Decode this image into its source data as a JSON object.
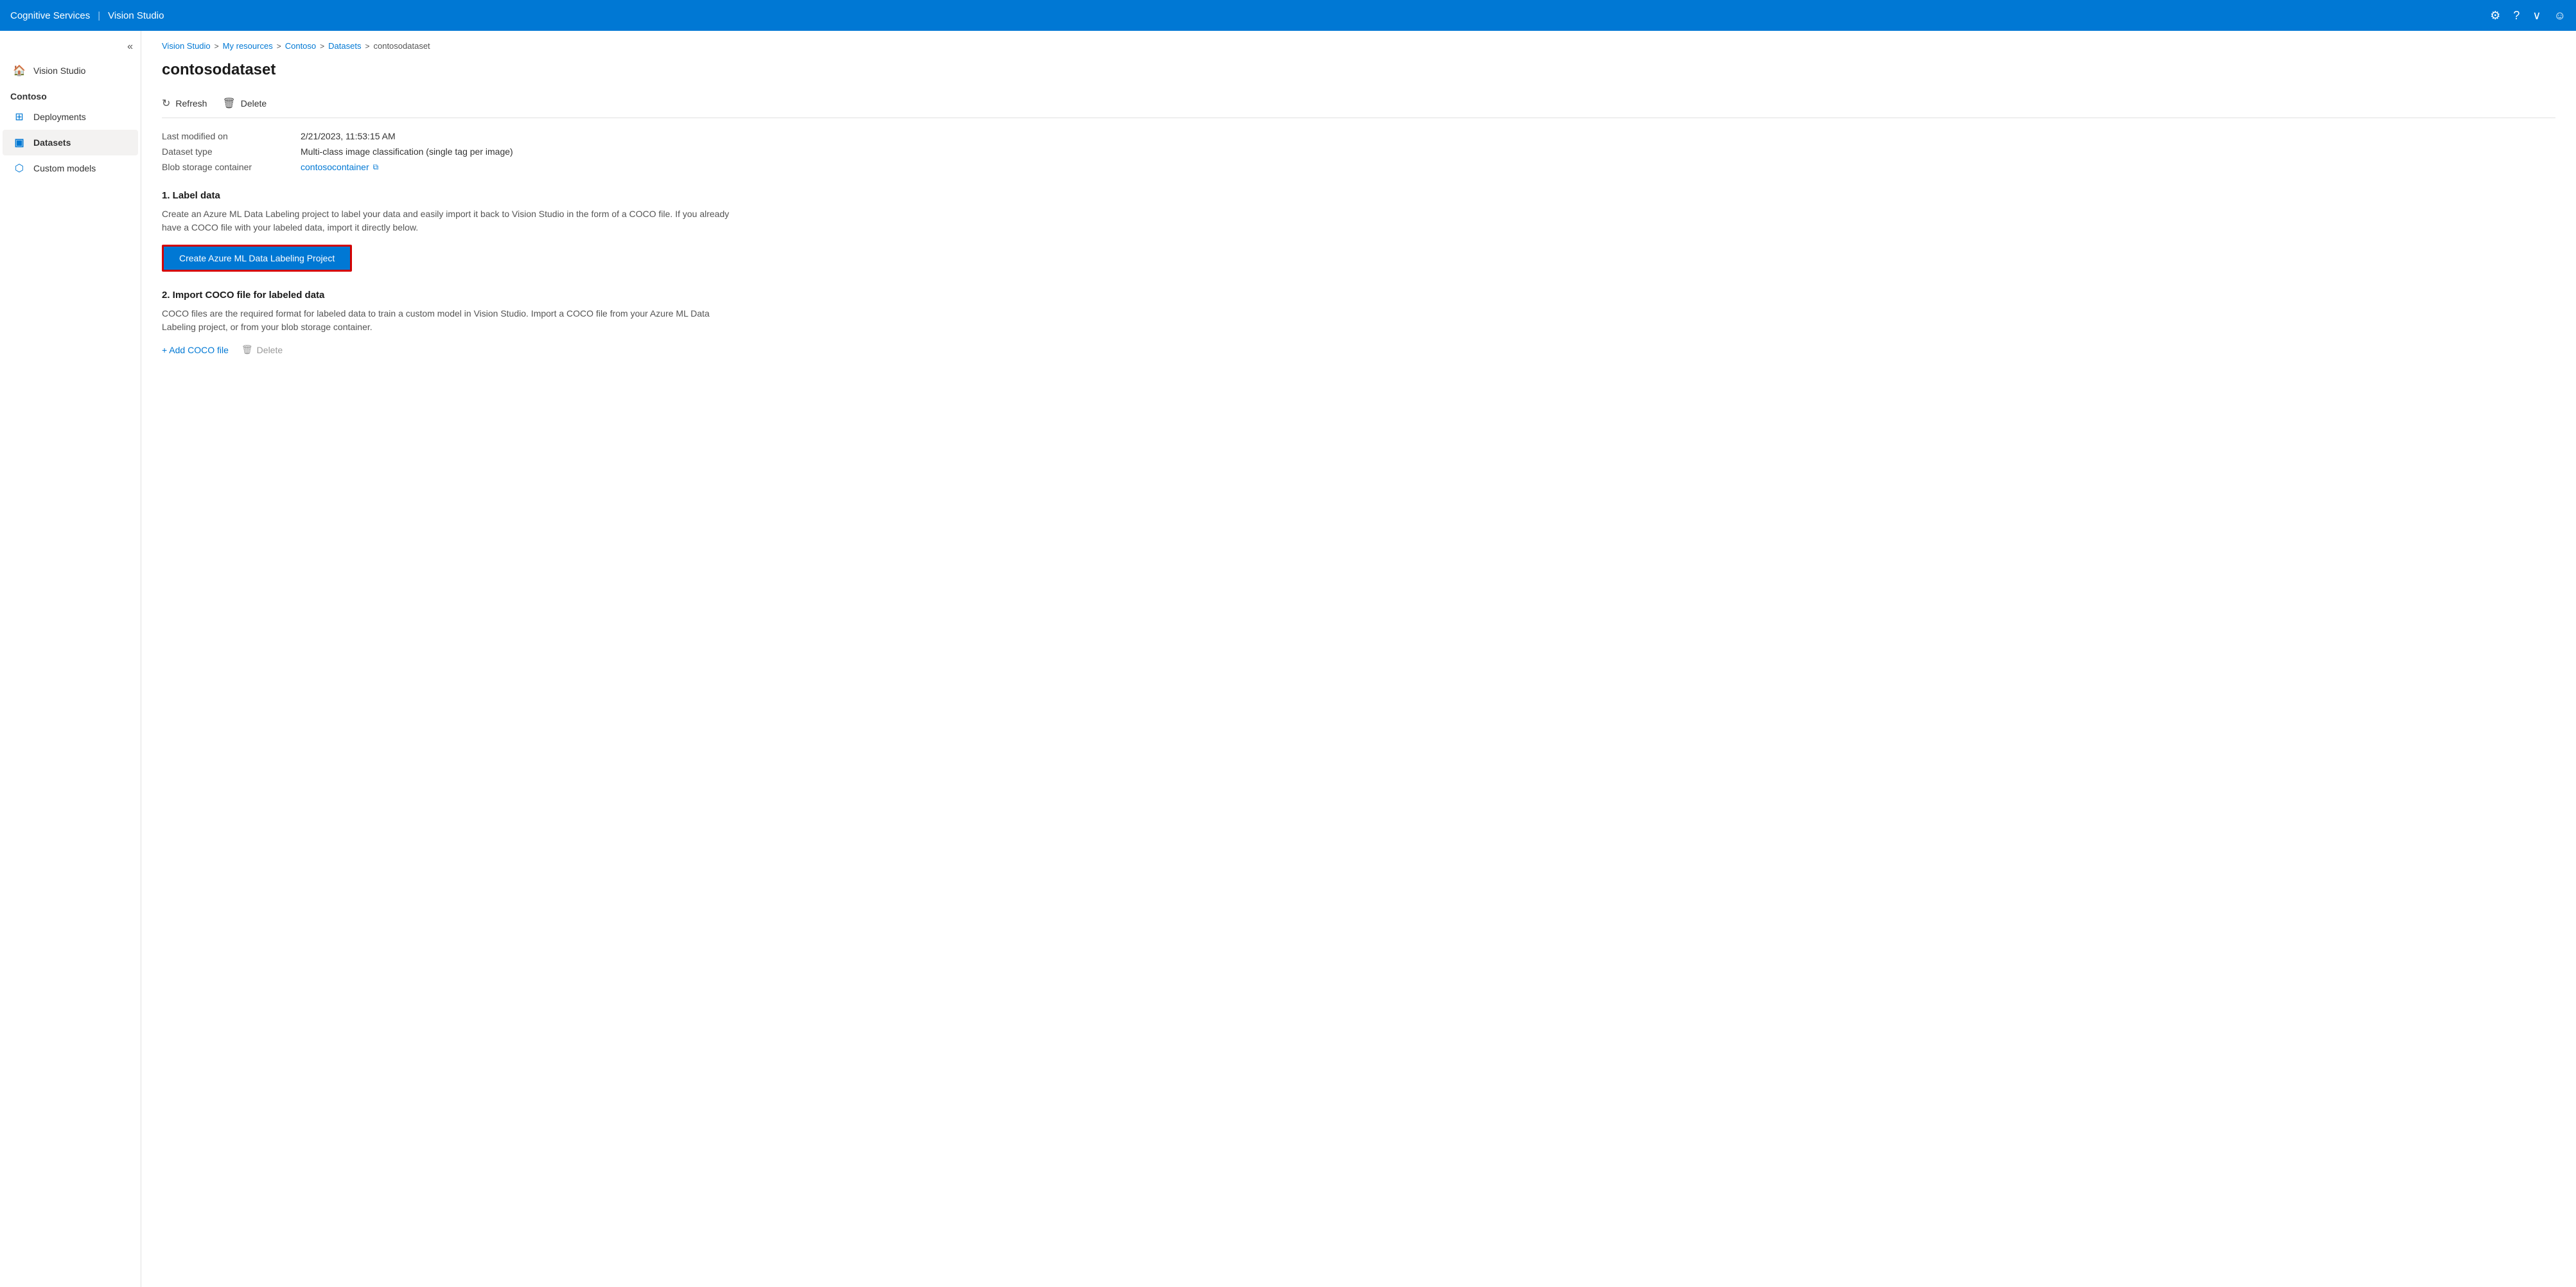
{
  "topNav": {
    "appName": "Cognitive Services",
    "separator": "|",
    "productName": "Vision Studio"
  },
  "breadcrumb": {
    "items": [
      "Vision Studio",
      "My resources",
      "Contoso",
      "Datasets",
      "contosodataset"
    ]
  },
  "pageTitle": "contosodataset",
  "toolbar": {
    "refreshLabel": "Refresh",
    "deleteLabel": "Delete"
  },
  "properties": {
    "lastModifiedLabel": "Last modified on",
    "lastModifiedValue": "2/21/2023, 11:53:15 AM",
    "datasetTypeLabel": "Dataset type",
    "datasetTypeValue": "Multi-class image classification (single tag per image)",
    "blobStorageLabel": "Blob storage container",
    "blobStorageValue": "contosocontainer"
  },
  "section1": {
    "title": "1. Label data",
    "description": "Create an Azure ML Data Labeling project to label your data and easily import it back to Vision Studio in the form of a COCO file. If you already have a COCO file with your labeled data, import it directly below.",
    "buttonLabel": "Create Azure ML Data Labeling Project"
  },
  "section2": {
    "title": "2. Import COCO file for labeled data",
    "description": "COCO files are the required format for labeled data to train a custom model in Vision Studio. Import a COCO file from your Azure ML Data Labeling project, or from your blob storage container.",
    "addCocoLabel": "+ Add COCO file",
    "deleteLabel": "Delete"
  },
  "sidebar": {
    "collapseLabel": "«",
    "sectionLabel": "Contoso",
    "items": [
      {
        "id": "vision-studio",
        "label": "Vision Studio",
        "icon": "🏠"
      },
      {
        "id": "deployments",
        "label": "Deployments",
        "icon": "⊞"
      },
      {
        "id": "datasets",
        "label": "Datasets",
        "icon": "▣",
        "active": true
      },
      {
        "id": "custom-models",
        "label": "Custom models",
        "icon": "⬡"
      }
    ]
  }
}
